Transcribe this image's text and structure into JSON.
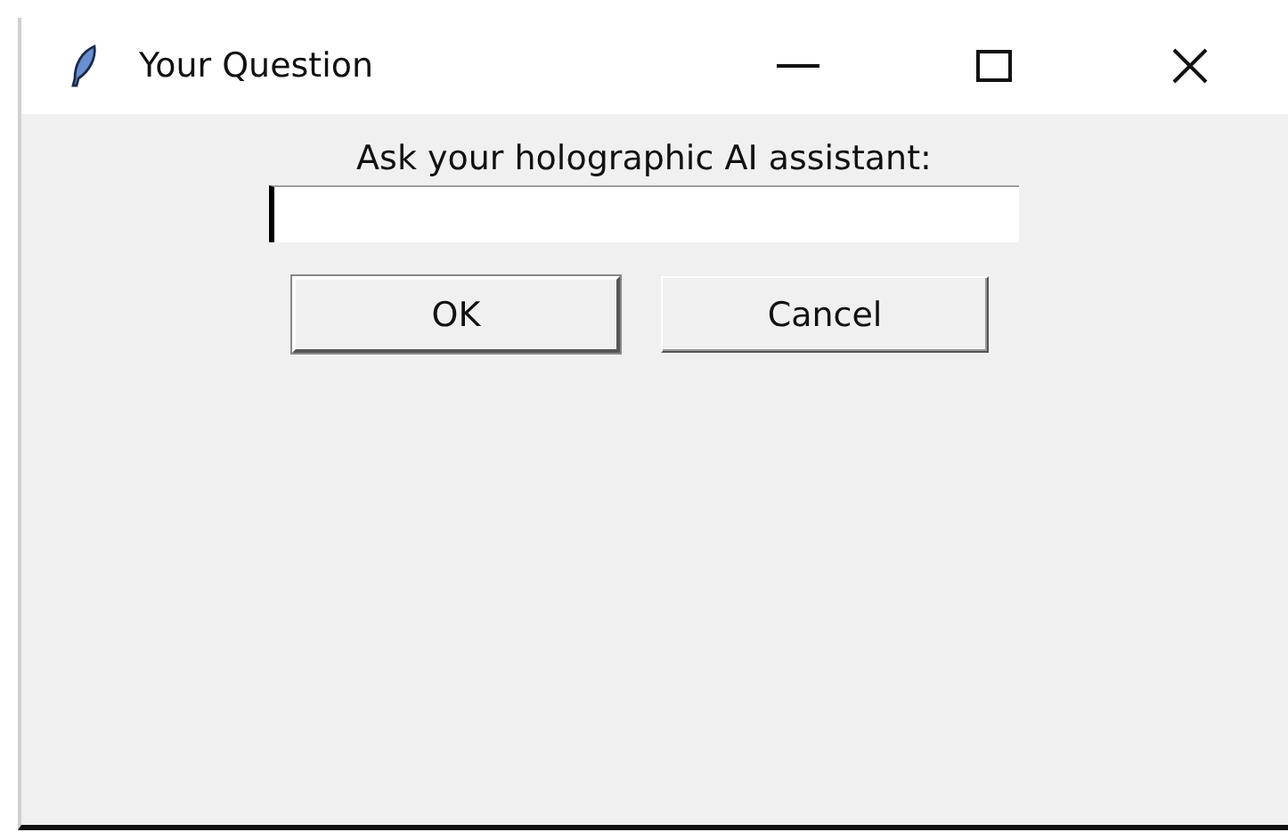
{
  "window": {
    "title": "Your Question"
  },
  "prompt": "Ask your holographic AI assistant:",
  "entry": {
    "focused": true
  },
  "buttons": [
    {
      "label": "OK",
      "default": true
    },
    {
      "label": "Cancel",
      "default": false
    }
  ]
}
